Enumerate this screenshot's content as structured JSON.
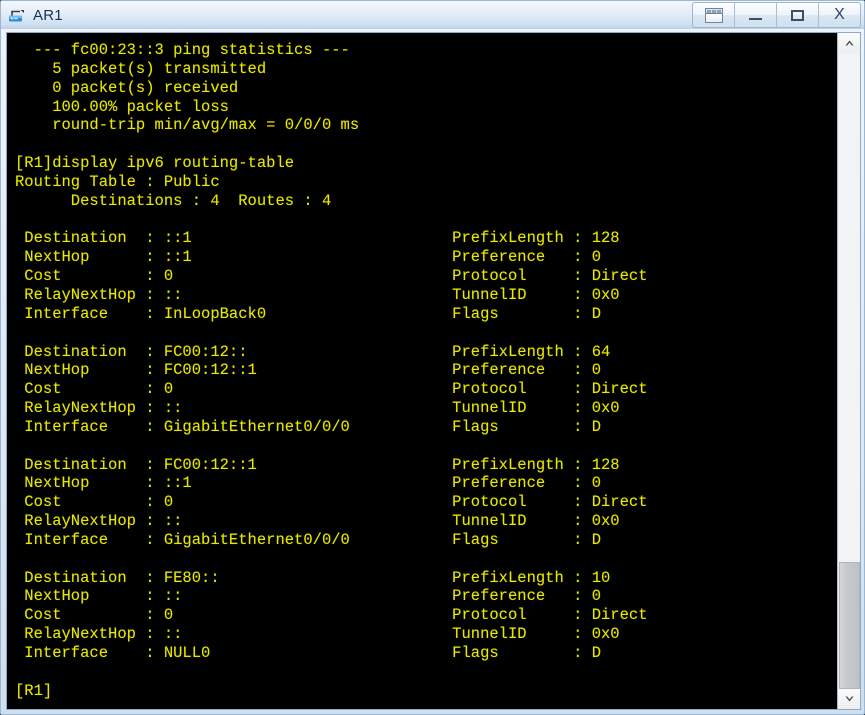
{
  "window": {
    "title": "AR1",
    "icon": "router-icon",
    "buttons": [
      {
        "name": "window-capture-button",
        "label": "",
        "icon": "window-icon"
      },
      {
        "name": "minimize-button",
        "label": "",
        "icon": "minimize-icon"
      },
      {
        "name": "maximize-button",
        "label": "",
        "icon": "maximize-icon"
      },
      {
        "name": "close-button",
        "label": "X",
        "icon": "close-icon"
      }
    ],
    "colors": {
      "titlebar_top": "#f2f7fc",
      "titlebar_bottom": "#b9d0e8",
      "frame_border": "#9cb6d0",
      "terminal_bg": "#000000",
      "terminal_fg": "#e8e800"
    }
  },
  "scrollbar": {
    "name": "vertical-scrollbar",
    "up_arrow": "chevron-up-icon",
    "down_arrow": "chevron-down-icon",
    "thumb_top_pct": 80,
    "thumb_height_pct": 20
  },
  "terminal": {
    "ping_statistics": {
      "header": "  --- fc00:23::3 ping statistics ---",
      "lines": [
        "    5 packet(s) transmitted",
        "    0 packet(s) received",
        "    100.00% packet loss",
        "    round-trip min/avg/max = 0/0/0 ms"
      ]
    },
    "command": "[R1]display ipv6 routing-table",
    "routing_table_header": "Routing Table : Public",
    "routing_table_counts": "      Destinations : 4  Routes : 4",
    "prompt": "[R1]",
    "field_labels_left": [
      "Destination",
      "NextHop",
      "Cost",
      "RelayNextHop",
      "Interface"
    ],
    "field_labels_right": [
      "PrefixLength",
      "Preference",
      "Protocol",
      "TunnelID",
      "Flags"
    ],
    "routes": [
      {
        "Destination": "::1",
        "NextHop": "::1",
        "Cost": "0",
        "RelayNextHop": "::",
        "Interface": "InLoopBack0",
        "PrefixLength": "128",
        "Preference": "0",
        "Protocol": "Direct",
        "TunnelID": "0x0",
        "Flags": "D"
      },
      {
        "Destination": "FC00:12::",
        "NextHop": "FC00:12::1",
        "Cost": "0",
        "RelayNextHop": "::",
        "Interface": "GigabitEthernet0/0/0",
        "PrefixLength": "64",
        "Preference": "0",
        "Protocol": "Direct",
        "TunnelID": "0x0",
        "Flags": "D"
      },
      {
        "Destination": "FC00:12::1",
        "NextHop": "::1",
        "Cost": "0",
        "RelayNextHop": "::",
        "Interface": "GigabitEthernet0/0/0",
        "PrefixLength": "128",
        "Preference": "0",
        "Protocol": "Direct",
        "TunnelID": "0x0",
        "Flags": "D"
      },
      {
        "Destination": "FE80::",
        "NextHop": "::",
        "Cost": "0",
        "RelayNextHop": "::",
        "Interface": "NULL0",
        "PrefixLength": "10",
        "Preference": "0",
        "Protocol": "Direct",
        "TunnelID": "0x0",
        "Flags": "D"
      }
    ]
  }
}
